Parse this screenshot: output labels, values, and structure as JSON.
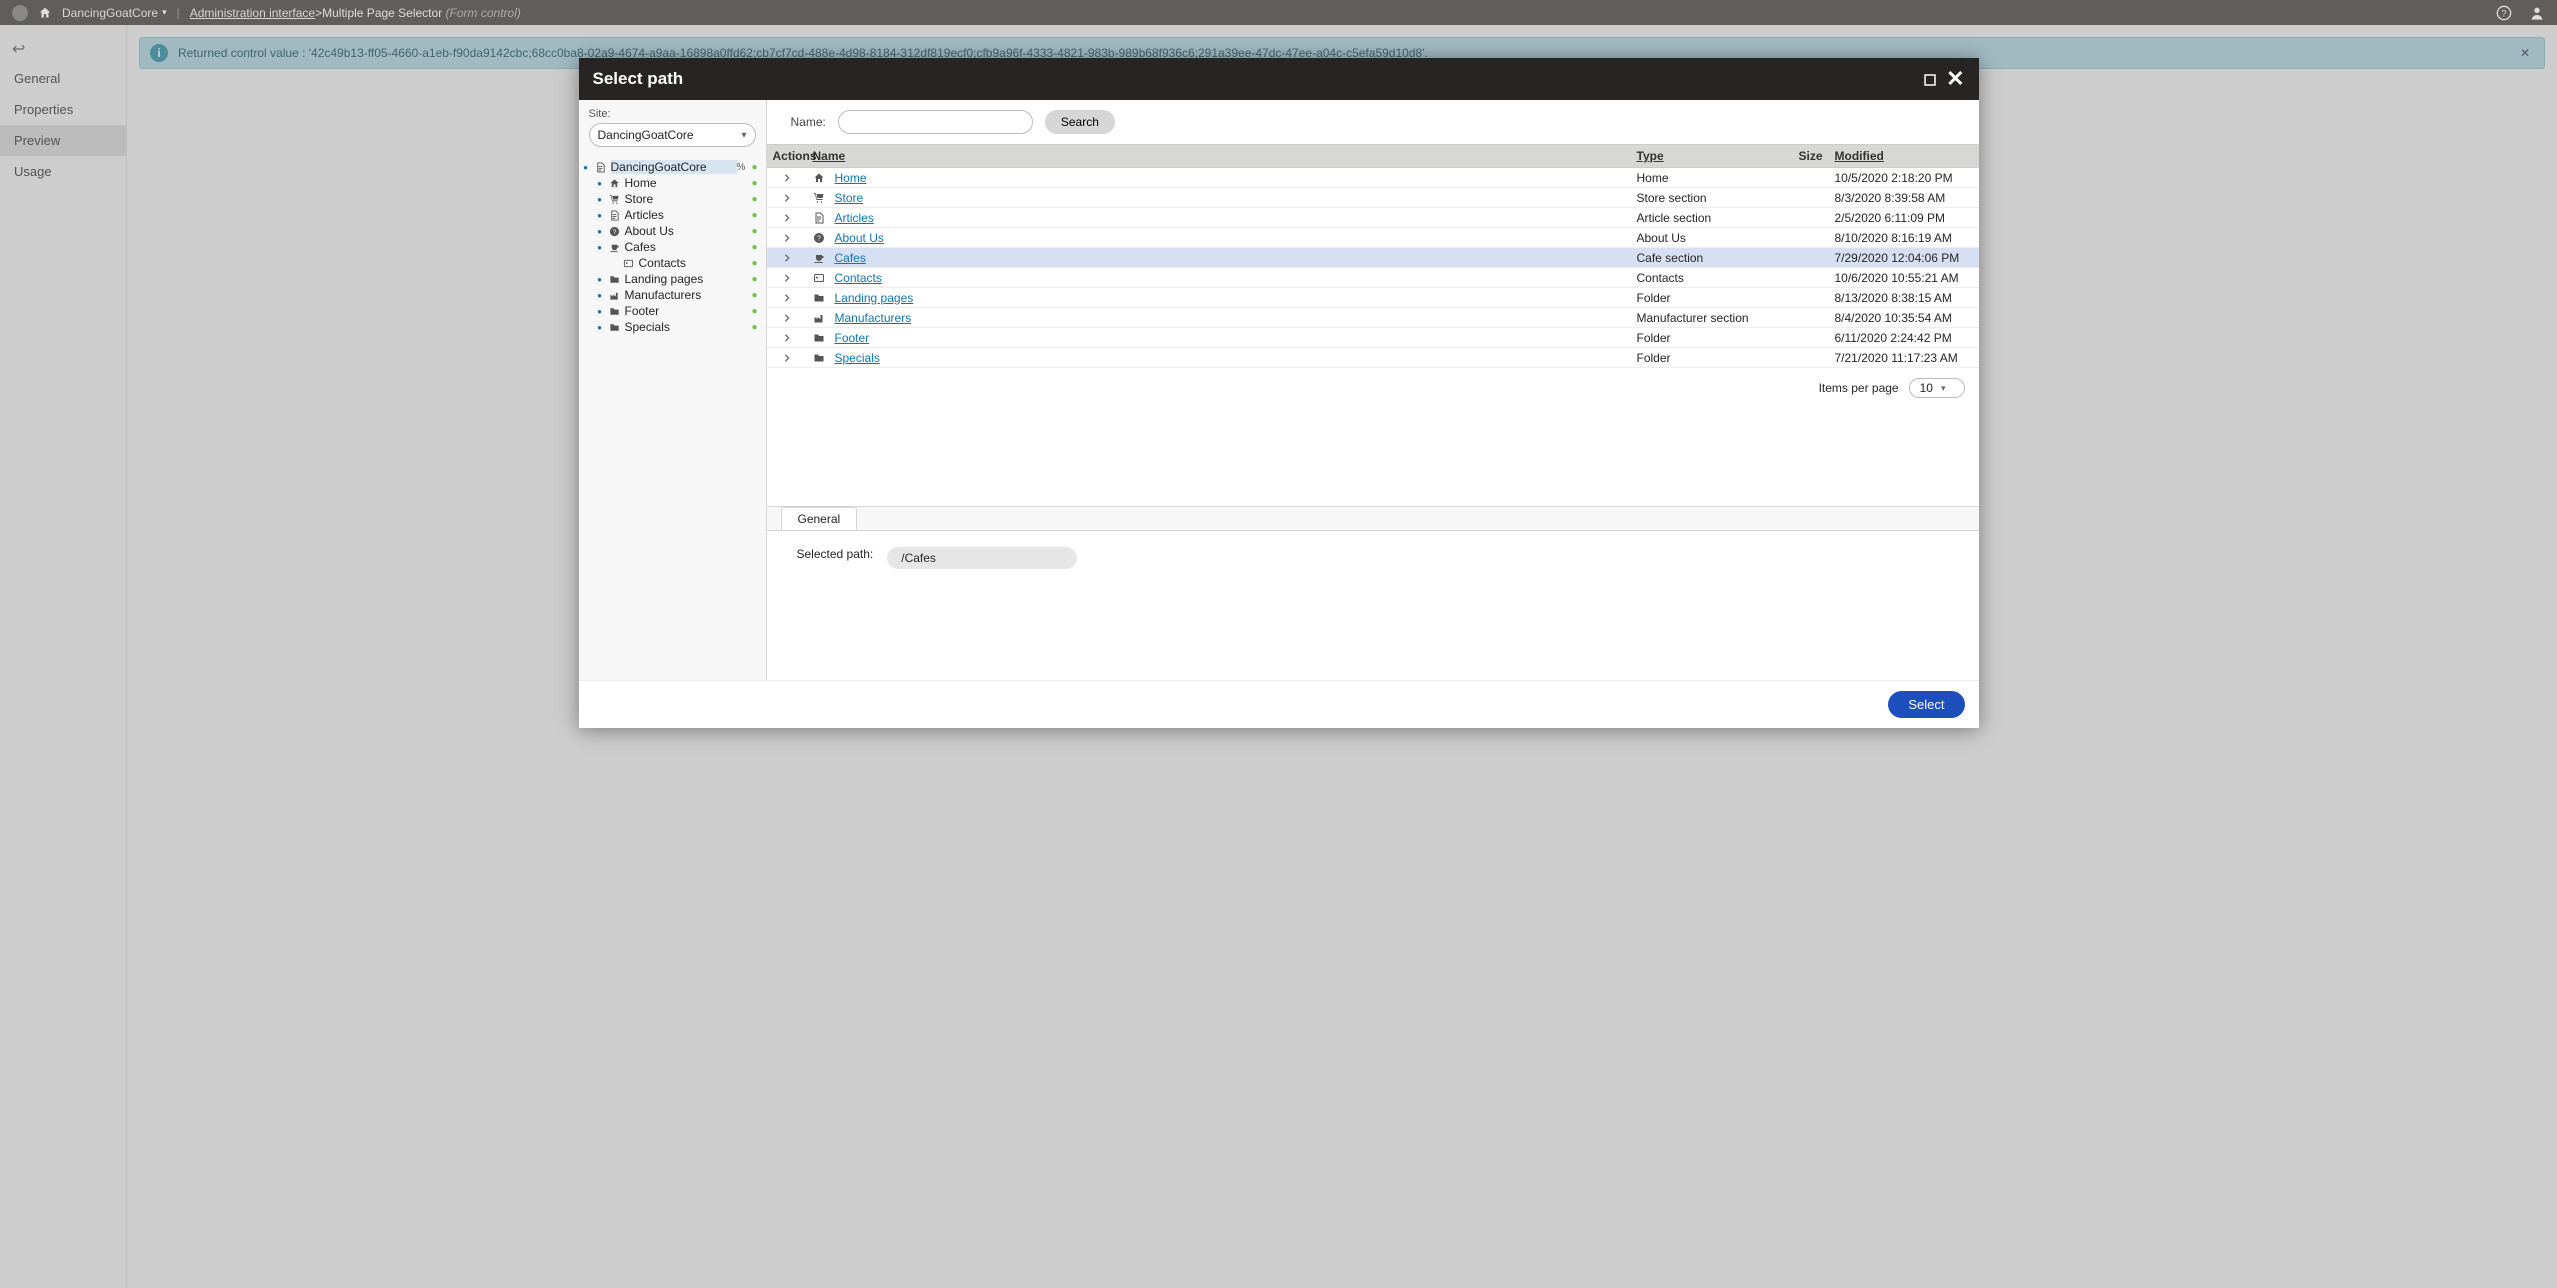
{
  "topbar": {
    "site_name": "DancingGoatCore",
    "crumb_admin": "Administration interface",
    "crumb_sep": " > ",
    "crumb_page": "Multiple Page Selector",
    "crumb_suffix": "(Form control)"
  },
  "left_nav": {
    "items": [
      "General",
      "Properties",
      "Preview",
      "Usage"
    ],
    "active": "Preview"
  },
  "banner": {
    "text": "Returned control value : '42c49b13-ff05-4660-a1eb-f90da9142cbc;68cc0ba8-02a9-4674-a9aa-16898a0ffd62;cb7cf7cd-488e-4d98-8184-312df819ecf0;cfb9a96f-4333-4821-983b-989b68f936c6;291a39ee-47dc-47ee-a04c-c5efa59d10d8'."
  },
  "modal": {
    "title": "Select path",
    "site_label": "Site:",
    "site_value": "DancingGoatCore",
    "search_label": "Name:",
    "search_button": "Search",
    "tree": {
      "root": "DancingGoatCore",
      "nodes": [
        {
          "label": "Home",
          "icon": "home"
        },
        {
          "label": "Store",
          "icon": "cart"
        },
        {
          "label": "Articles",
          "icon": "doc"
        },
        {
          "label": "About Us",
          "icon": "question"
        },
        {
          "label": "Cafes",
          "icon": "cup"
        },
        {
          "label": "Contacts",
          "icon": "card",
          "leaf": true
        },
        {
          "label": "Landing pages",
          "icon": "folder"
        },
        {
          "label": "Manufacturers",
          "icon": "factory"
        },
        {
          "label": "Footer",
          "icon": "folder"
        },
        {
          "label": "Specials",
          "icon": "folder"
        }
      ]
    },
    "grid": {
      "headers": {
        "actions": "Actions",
        "name": "Name",
        "type": "Type",
        "size": "Size",
        "modified": "Modified"
      },
      "rows": [
        {
          "name": "Home",
          "type": "Home",
          "modified": "10/5/2020 2:18:20 PM",
          "icon": "home"
        },
        {
          "name": "Store",
          "type": "Store section",
          "modified": "8/3/2020 8:39:58 AM",
          "icon": "cart"
        },
        {
          "name": "Articles",
          "type": "Article section",
          "modified": "2/5/2020 6:11:09 PM",
          "icon": "doc"
        },
        {
          "name": "About Us",
          "type": "About Us",
          "modified": "8/10/2020 8:16:19 AM",
          "icon": "question"
        },
        {
          "name": "Cafes",
          "type": "Cafe section",
          "modified": "7/29/2020 12:04:06 PM",
          "icon": "cup",
          "selected": true
        },
        {
          "name": "Contacts",
          "type": "Contacts",
          "modified": "10/6/2020 10:55:21 AM",
          "icon": "card"
        },
        {
          "name": "Landing pages",
          "type": "Folder",
          "modified": "8/13/2020 8:38:15 AM",
          "icon": "folder"
        },
        {
          "name": "Manufacturers",
          "type": "Manufacturer section",
          "modified": "8/4/2020 10:35:54 AM",
          "icon": "factory"
        },
        {
          "name": "Footer",
          "type": "Folder",
          "modified": "6/11/2020 2:24:42 PM",
          "icon": "folder"
        },
        {
          "name": "Specials",
          "type": "Folder",
          "modified": "7/21/2020 11:17:23 AM",
          "icon": "folder"
        }
      ],
      "pager_label": "Items per page",
      "pager_value": "10"
    },
    "detail": {
      "tab": "General",
      "selected_path_label": "Selected path:",
      "selected_path_value": "/Cafes"
    },
    "footer": {
      "select": "Select"
    }
  }
}
